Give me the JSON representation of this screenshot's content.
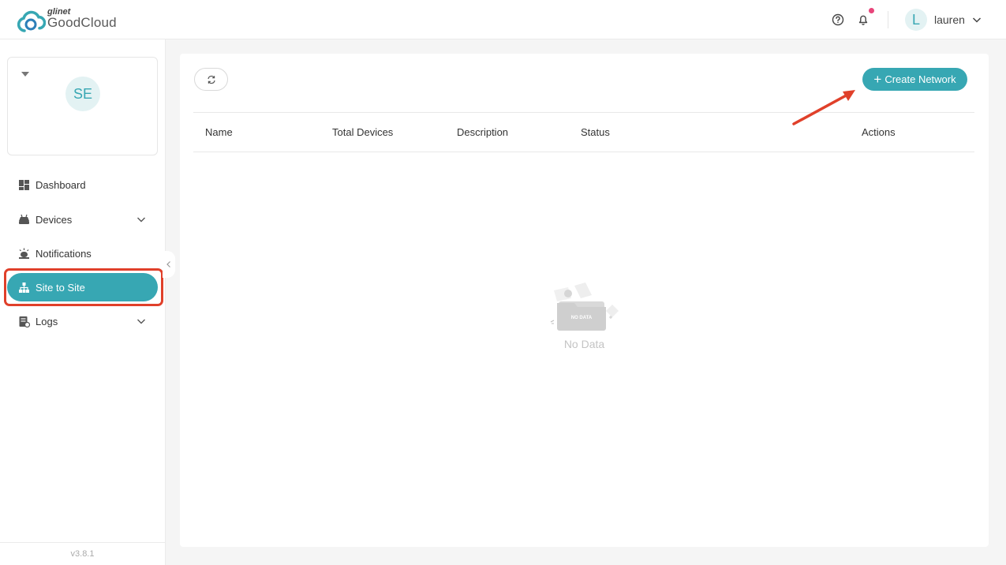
{
  "header": {
    "brand_small": "glinet",
    "brand_name": "GoodCloud",
    "user_initial": "L",
    "user_name": "lauren"
  },
  "sidebar": {
    "org_avatar": "SE",
    "items": [
      {
        "label": "Dashboard",
        "icon": "dashboard-icon"
      },
      {
        "label": "Devices",
        "icon": "devices-icon"
      },
      {
        "label": "Notifications",
        "icon": "notifications-icon"
      },
      {
        "label": "Site to Site",
        "icon": "sitemap-icon",
        "active": true
      },
      {
        "label": "Logs",
        "icon": "logs-icon"
      }
    ],
    "version": "v3.8.1"
  },
  "main": {
    "create_label": "Create Network",
    "columns": [
      "Name",
      "Total Devices",
      "Description",
      "Status",
      "Actions"
    ],
    "empty_badge": "NO DATA",
    "empty_text": "No Data"
  },
  "colors": {
    "accent": "#37a7b3",
    "annotation": "#e0402a",
    "notification_dot": "#e8457a"
  }
}
